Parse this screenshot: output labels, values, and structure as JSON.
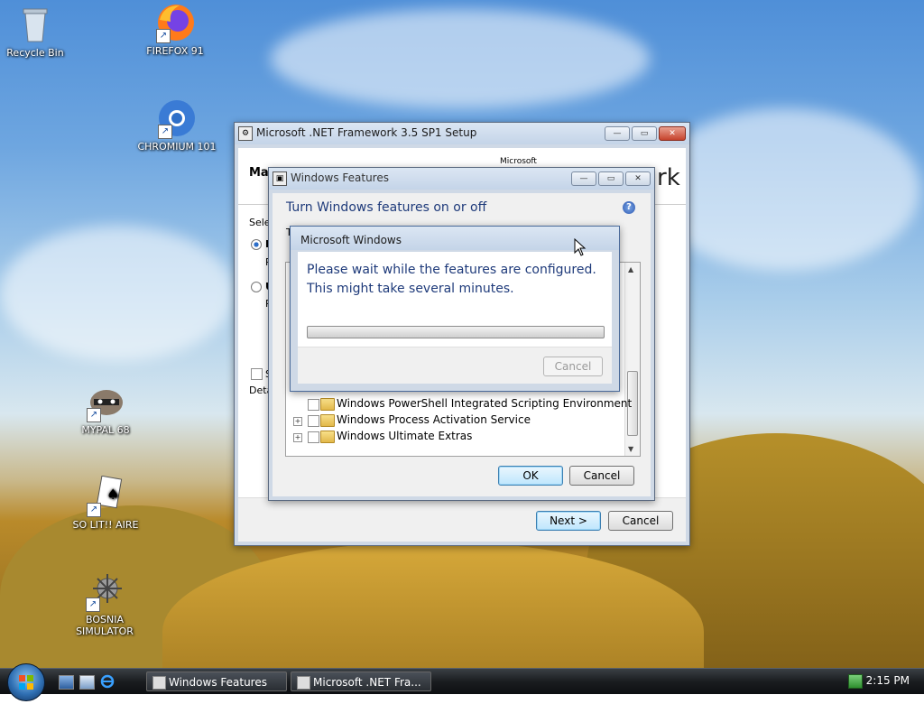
{
  "desktop_icons": [
    {
      "label": "Recycle Bin"
    },
    {
      "label": "FIREFOX 91"
    },
    {
      "label": "CHROMIUM 101"
    },
    {
      "label": "MYPAL 68"
    },
    {
      "label": "SO LIT!! AIRE"
    },
    {
      "label": "BOSNIA SIMULATOR"
    }
  ],
  "setup_window": {
    "title": "Microsoft .NET Framework 3.5 SP1 Setup",
    "heading_fragment": "Mai",
    "brand_small": "Microsoft",
    "brand_fragment": "rk",
    "select_fragment": "Selec",
    "radio1_fragment": "R",
    "radio1_sub_fragment": "R",
    "radio2_fragment": "U",
    "radio2_sub_fragment": "R",
    "checkbox_fragment": "S",
    "details_fragment": "Deta",
    "next_label": "Next >",
    "cancel_label": "Cancel"
  },
  "features_window": {
    "title": "Windows Features",
    "heading": "Turn Windows features on or off",
    "heading_fragment": "T",
    "items": [
      {
        "label": "Windows PowerShell Integrated Scripting Environment",
        "expandable": false
      },
      {
        "label": "Windows Process Activation Service",
        "expandable": true
      },
      {
        "label": "Windows Ultimate Extras",
        "expandable": true
      }
    ],
    "ok_label": "OK",
    "cancel_label": "Cancel"
  },
  "progress_dialog": {
    "title": "Microsoft Windows",
    "message_line1": "Please wait while the features are configured.",
    "message_line2": "This might take several minutes.",
    "cancel_label": "Cancel"
  },
  "taskbar": {
    "tasks": [
      {
        "label": "Windows Features"
      },
      {
        "label": "Microsoft .NET Fra..."
      }
    ],
    "clock": "2:15 PM"
  }
}
